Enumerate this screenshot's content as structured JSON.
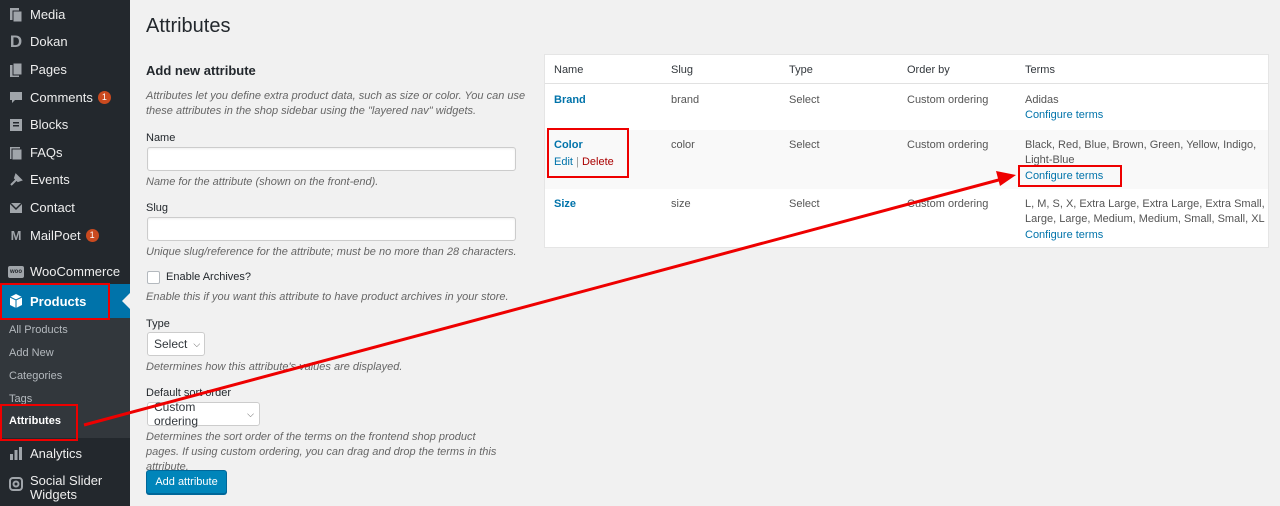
{
  "sidebar": {
    "items": [
      {
        "label": "Media",
        "icon": "media-icon"
      },
      {
        "label": "Dokan",
        "icon": "dokan-icon"
      },
      {
        "label": "Pages",
        "icon": "pages-icon"
      },
      {
        "label": "Comments",
        "icon": "comments-icon",
        "badge": "1"
      },
      {
        "label": "Blocks",
        "icon": "blocks-icon"
      },
      {
        "label": "FAQs",
        "icon": "faqs-icon"
      },
      {
        "label": "Events",
        "icon": "events-icon"
      },
      {
        "label": "Contact",
        "icon": "contact-icon"
      },
      {
        "label": "MailPoet",
        "icon": "mailpoet-icon",
        "badge": "1"
      },
      {
        "label": "WooCommerce",
        "icon": "woocommerce-icon"
      },
      {
        "label": "Products",
        "icon": "products-icon"
      },
      {
        "label": "Analytics",
        "icon": "analytics-icon"
      },
      {
        "label": "Social Slider Widgets",
        "icon": "social-slider-icon"
      }
    ],
    "submenu": [
      "All Products",
      "Add New",
      "Categories",
      "Tags",
      "Attributes"
    ]
  },
  "page": {
    "title": "Attributes"
  },
  "form": {
    "heading": "Add new attribute",
    "intro": "Attributes let you define extra product data, such as size or color. You can use these attributes in the shop sidebar using the \"layered nav\" widgets.",
    "name_label": "Name",
    "name_value": "",
    "name_desc": "Name for the attribute (shown on the front-end).",
    "slug_label": "Slug",
    "slug_value": "",
    "slug_desc": "Unique slug/reference for the attribute; must be no more than 28 characters.",
    "archives_label": "Enable Archives?",
    "archives_desc": "Enable this if you want this attribute to have product archives in your store.",
    "type_label": "Type",
    "type_value": "Select",
    "type_desc": "Determines how this attribute's values are displayed.",
    "sort_label": "Default sort order",
    "sort_value": "Custom ordering",
    "sort_desc": "Determines the sort order of the terms on the frontend shop product pages. If using custom ordering, you can drag and drop the terms in this attribute.",
    "submit_label": "Add attribute"
  },
  "table": {
    "columns": [
      "Name",
      "Slug",
      "Type",
      "Order by",
      "Terms"
    ],
    "rows": [
      {
        "name": "Brand",
        "slug": "brand",
        "type": "Select",
        "order_by": "Custom ordering",
        "terms": "Adidas",
        "configure": "Configure terms"
      },
      {
        "name": "Color",
        "slug": "color",
        "type": "Select",
        "order_by": "Custom ordering",
        "terms_line1": "Black, Red, Blue, Brown, Green, Yellow, Indigo,",
        "terms_line2": "Light-Blue",
        "configure": "Configure terms",
        "edit": "Edit",
        "delete": "Delete",
        "separator": "|"
      },
      {
        "name": "Size",
        "slug": "size",
        "type": "Select",
        "order_by": "Custom ordering",
        "terms_line1": "L, M, S, X, Extra Large, Extra Large, Extra Small,",
        "terms_line2": "Large, Large, Medium, Medium, Small, Small, XL",
        "configure": "Configure terms"
      }
    ]
  },
  "colors": {
    "sidebar_bg": "#23282d",
    "accent": "#0073aa",
    "annotation": "#e00000",
    "badge": "#ca4a1f"
  }
}
